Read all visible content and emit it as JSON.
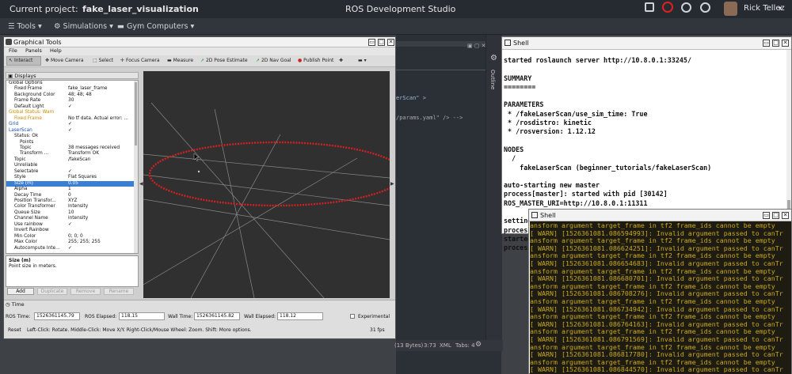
{
  "topbar": {
    "project_label": "Current project:",
    "project_name": "fake_laser_visualization",
    "app_title": "ROS Development Studio",
    "user_name": "Rick Tellez"
  },
  "toolbar": {
    "tools": "Tools",
    "simulations": "Simulations",
    "gym": "Gym Computers"
  },
  "rviz": {
    "title": "Graphical Tools",
    "menu": [
      "File",
      "Panels",
      "Help"
    ],
    "tools": [
      "Interact",
      "Move Camera",
      "Select",
      "Focus Camera",
      "Measure",
      "2D Pose Estimate",
      "2D Nav Goal",
      "Publish Point"
    ],
    "displays_title": "Displays",
    "rows": [
      {
        "k": "Global Options",
        "v": "",
        "d": 0
      },
      {
        "k": "Fixed Frame",
        "v": "fake_laser_frame",
        "d": 1
      },
      {
        "k": "Background Color",
        "v": "48; 48; 48",
        "d": 1
      },
      {
        "k": "Frame Rate",
        "v": "30",
        "d": 1
      },
      {
        "k": "Default Light",
        "v": "✓",
        "d": 1
      },
      {
        "k": "Global Status: Warn",
        "v": "",
        "d": 0,
        "warn": true
      },
      {
        "k": "Fixed Frame",
        "v": "No tf data.  Actual error: ...",
        "d": 1,
        "warn": true
      },
      {
        "k": "Grid",
        "v": "✓",
        "d": 0,
        "blue": true
      },
      {
        "k": "LaserScan",
        "v": "✓",
        "d": 0,
        "blue": true
      },
      {
        "k": "Status: Ok",
        "v": "",
        "d": 1
      },
      {
        "k": "Points",
        "v": "",
        "d": 2
      },
      {
        "k": "Topic",
        "v": "38 messages received",
        "d": 2
      },
      {
        "k": "Transform ...",
        "v": "Transform OK",
        "d": 2
      },
      {
        "k": "Topic",
        "v": "/fakeScan",
        "d": 1
      },
      {
        "k": "Unreliable",
        "v": "",
        "d": 1
      },
      {
        "k": "Selectable",
        "v": "✓",
        "d": 1
      },
      {
        "k": "Style",
        "v": "Flat Squares",
        "d": 1
      },
      {
        "k": "Size (m)",
        "v": "0.05",
        "d": 1,
        "sel": true
      },
      {
        "k": "Alpha",
        "v": "1",
        "d": 1
      },
      {
        "k": "Decay Time",
        "v": "0",
        "d": 1
      },
      {
        "k": "Position Transfor...",
        "v": "XYZ",
        "d": 1
      },
      {
        "k": "Color Transformer",
        "v": "Intensity",
        "d": 1
      },
      {
        "k": "Queue Size",
        "v": "10",
        "d": 1
      },
      {
        "k": "Channel Name",
        "v": "intensity",
        "d": 1
      },
      {
        "k": "Use rainbow",
        "v": "✓",
        "d": 1
      },
      {
        "k": "Invert Rainbow",
        "v": "",
        "d": 1
      },
      {
        "k": "Min Color",
        "v": "0; 0; 0",
        "d": 1
      },
      {
        "k": "Max Color",
        "v": "255; 255; 255",
        "d": 1
      },
      {
        "k": "Autocompute Inte...",
        "v": "✓",
        "d": 1
      }
    ],
    "desc_title": "Size (m)",
    "desc_text": "Point size in meters.",
    "buttons": [
      "Add",
      "Duplicate",
      "Remove",
      "Rename"
    ],
    "time_title": "Time",
    "ros_time_label": "ROS Time:",
    "ros_time": "1526361145.79",
    "ros_elapsed_label": "ROS Elapsed:",
    "ros_elapsed": "118.15",
    "wall_time_label": "Wall Time:",
    "wall_time": "1526361145.82",
    "wall_elapsed_label": "Wall Elapsed:",
    "wall_elapsed": "118.12",
    "experimental": "Experimental",
    "reset": "Reset",
    "hint": "Left-Click: Rotate.  Middle-Click: Move X/Y.  Right-Click/Mouse Wheel: Zoom.  Shift: More options.",
    "fps": "31 fps"
  },
  "editor": {
    "line1": "erScan\" >",
    "line2": "/params.yaml\" /> -->",
    "outline": "Outline"
  },
  "statusbar": {
    "bytes": "(13 Bytes)",
    "pos": "3:73",
    "lang": "XML",
    "tabs": "Tabs: 4"
  },
  "shell1": {
    "title": "Shell",
    "text": "started roslaunch server http://10.8.0.1:33245/\n\nSUMMARY\n========\n\nPARAMETERS\n * /fakeLaserScan/use_sim_time: True\n * /rosdistro: kinetic\n * /rosversion: 1.12.12\n\nNODES\n  /\n    fakeLaserScan (beginner_tutorials/fakeLaserScan)\n\nauto-starting new master\nprocess[master]: started with pid [30142]\nROS_MASTER_URI=http://10.8.0.1:11311\n\nsetting /run_id to d37bc0ec-57fd-11e8-a8cd-0618e3f197b4\nprocess[rosout-1]: started with pid [30165]\nstarted\nprocess"
  },
  "shell2": {
    "title": "Shell",
    "lines": [
      "ansform argument target_frame in tf2 frame_ids cannot be empty",
      "[ WARN] [1526361081.086594993]: Invalid argument passed to canTr",
      "ansform argument target_frame in tf2 frame_ids cannot be empty",
      "[ WARN] [1526361081.086624251]: Invalid argument passed to canTr",
      "ansform argument target_frame in tf2 frame_ids cannot be empty",
      "[ WARN] [1526361081.086654683]: Invalid argument passed to canTr",
      "ansform argument target_frame in tf2 frame_ids cannot be empty",
      "[ WARN] [1526361081.086680701]: Invalid argument passed to canTr",
      "ansform argument target_frame in tf2 frame_ids cannot be empty",
      "[ WARN] [1526361081.086708276]: Invalid argument passed to canTr",
      "ansform argument target_frame in tf2 frame_ids cannot be empty",
      "[ WARN] [1526361081.086734942]: Invalid argument passed to canTr",
      "ansform argument target_frame in tf2 frame_ids cannot be empty",
      "[ WARN] [1526361081.086764163]: Invalid argument passed to canTr",
      "ansform argument target_frame in tf2 frame_ids cannot be empty",
      "[ WARN] [1526361081.086791569]: Invalid argument passed to canTr",
      "ansform argument target_frame in tf2 frame_ids cannot be empty",
      "[ WARN] [1526361081.086817780]: Invalid argument passed to canTr",
      "ansform argument target_frame in tf2 frame_ids cannot be empty",
      "[ WARN] [1526361081.086844570]: Invalid argument passed to canTr"
    ]
  }
}
